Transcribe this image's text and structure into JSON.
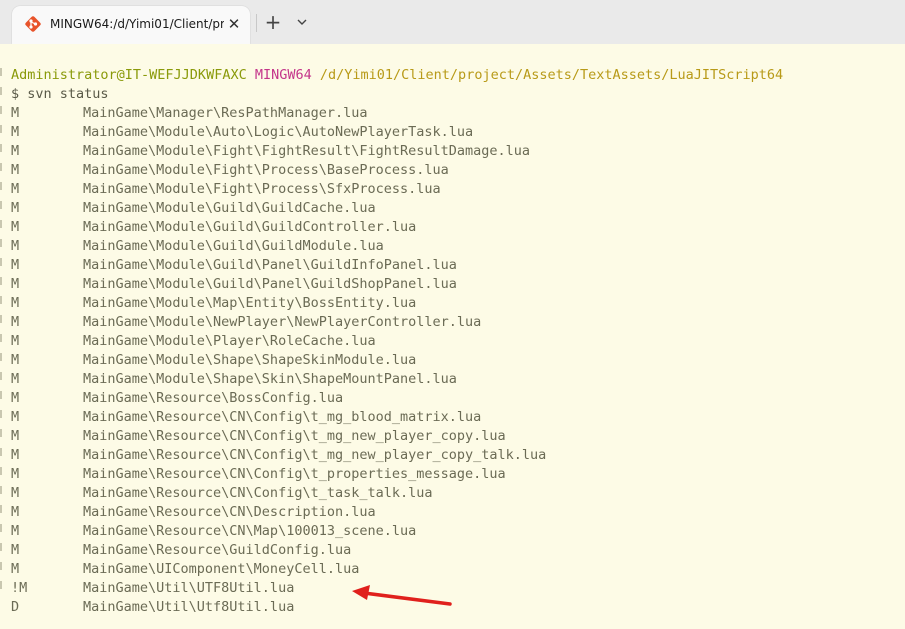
{
  "window": {
    "tab_title": "MINGW64:/d/Yimi01/Client/pr",
    "close_symbol": "✕",
    "new_tab_symbol": "+"
  },
  "terminal": {
    "prompt": {
      "user": "Administrator@IT-WEFJJDKWFAXC",
      "system": "MINGW64",
      "path": "/d/Yimi01/Client/project/Assets/TextAssets/LuaJITScript64"
    },
    "command": "$ svn status",
    "entries": [
      {
        "status": "M",
        "path": "MainGame\\Manager\\ResPathManager.lua"
      },
      {
        "status": "M",
        "path": "MainGame\\Module\\Auto\\Logic\\AutoNewPlayerTask.lua"
      },
      {
        "status": "M",
        "path": "MainGame\\Module\\Fight\\FightResult\\FightResultDamage.lua"
      },
      {
        "status": "M",
        "path": "MainGame\\Module\\Fight\\Process\\BaseProcess.lua"
      },
      {
        "status": "M",
        "path": "MainGame\\Module\\Fight\\Process\\SfxProcess.lua"
      },
      {
        "status": "M",
        "path": "MainGame\\Module\\Guild\\GuildCache.lua"
      },
      {
        "status": "M",
        "path": "MainGame\\Module\\Guild\\GuildController.lua"
      },
      {
        "status": "M",
        "path": "MainGame\\Module\\Guild\\GuildModule.lua"
      },
      {
        "status": "M",
        "path": "MainGame\\Module\\Guild\\Panel\\GuildInfoPanel.lua"
      },
      {
        "status": "M",
        "path": "MainGame\\Module\\Guild\\Panel\\GuildShopPanel.lua"
      },
      {
        "status": "M",
        "path": "MainGame\\Module\\Map\\Entity\\BossEntity.lua"
      },
      {
        "status": "M",
        "path": "MainGame\\Module\\NewPlayer\\NewPlayerController.lua"
      },
      {
        "status": "M",
        "path": "MainGame\\Module\\Player\\RoleCache.lua"
      },
      {
        "status": "M",
        "path": "MainGame\\Module\\Shape\\ShapeSkinModule.lua"
      },
      {
        "status": "M",
        "path": "MainGame\\Module\\Shape\\Skin\\ShapeMountPanel.lua"
      },
      {
        "status": "M",
        "path": "MainGame\\Resource\\BossConfig.lua"
      },
      {
        "status": "M",
        "path": "MainGame\\Resource\\CN\\Config\\t_mg_blood_matrix.lua"
      },
      {
        "status": "M",
        "path": "MainGame\\Resource\\CN\\Config\\t_mg_new_player_copy.lua"
      },
      {
        "status": "M",
        "path": "MainGame\\Resource\\CN\\Config\\t_mg_new_player_copy_talk.lua"
      },
      {
        "status": "M",
        "path": "MainGame\\Resource\\CN\\Config\\t_properties_message.lua"
      },
      {
        "status": "M",
        "path": "MainGame\\Resource\\CN\\Config\\t_task_talk.lua"
      },
      {
        "status": "M",
        "path": "MainGame\\Resource\\CN\\Description.lua"
      },
      {
        "status": "M",
        "path": "MainGame\\Resource\\CN\\Map\\100013_scene.lua"
      },
      {
        "status": "M",
        "path": "MainGame\\Resource\\GuildConfig.lua"
      },
      {
        "status": "M",
        "path": "MainGame\\UIComponent\\MoneyCell.lua"
      },
      {
        "status": "!M",
        "path": "MainGame\\Util\\UTF8Util.lua"
      },
      {
        "status": "D",
        "path": "MainGame\\Util\\Utf8Util.lua"
      }
    ]
  },
  "colors": {
    "background": "#fdfbe6",
    "prompt_user": "#8a9a0a",
    "prompt_system": "#c4358a",
    "prompt_path": "#b89a18",
    "text": "#6b6b55",
    "annotation_arrow": "#e0201c"
  },
  "icons": {
    "tab": "git-bash-icon",
    "close": "close-icon",
    "new_tab": "plus-icon",
    "dropdown": "chevron-down-icon",
    "annotation": "red-arrow-icon"
  }
}
